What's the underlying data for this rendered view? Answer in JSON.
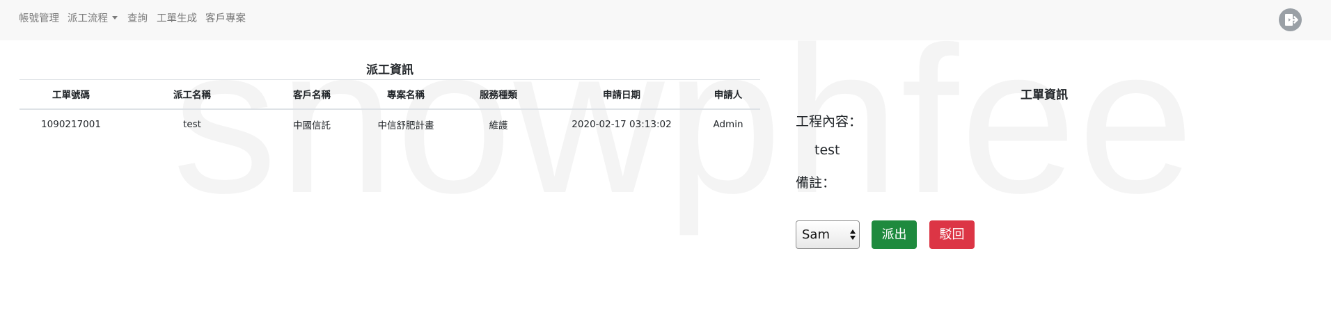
{
  "nav": {
    "items": [
      "帳號管理",
      "派工流程",
      "查詢",
      "工單生成",
      "客戶專案"
    ],
    "logout_icon": "logout-icon"
  },
  "watermark": "snowphfee",
  "dispatch_table": {
    "title": "派工資訊",
    "columns": [
      "工單號碼",
      "派工名稱",
      "客戶名稱",
      "專案名稱",
      "服務種類",
      "申請日期",
      "申請人"
    ],
    "rows": [
      [
        "1090217001",
        "test",
        "中國信託",
        "中信舒肥計畫",
        "維護",
        "2020-02-17 03:13:02",
        "Admin"
      ]
    ]
  },
  "work_order": {
    "title": "工單資訊",
    "content_label": "工程內容：",
    "content_value": "test",
    "note_label": "備註：",
    "assignee_selected": "Sam",
    "dispatch_button": "派出",
    "reject_button": "駁回"
  },
  "colors": {
    "navbar_bg": "#f8f8f8",
    "nav_text": "#7a7a7a",
    "dispatch_green": "#1e8a3e",
    "reject_red": "#dc3545",
    "watermark": "#f4f4f4"
  }
}
